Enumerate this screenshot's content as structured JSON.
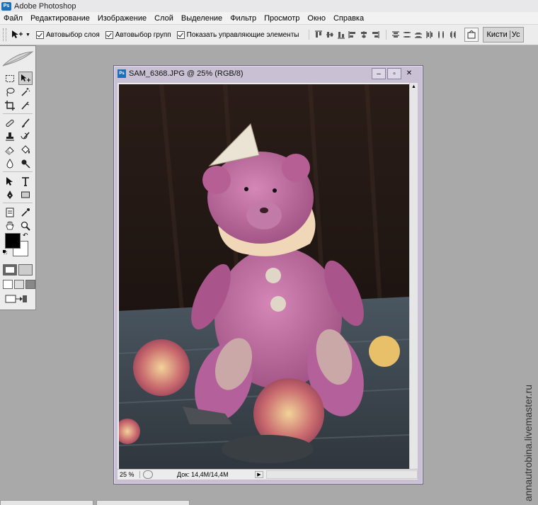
{
  "app": {
    "title": "Adobe Photoshop",
    "icon_label": "Ps"
  },
  "menu": [
    "Файл",
    "Редактирование",
    "Изображение",
    "Слой",
    "Выделение",
    "Фильтр",
    "Просмотр",
    "Окно",
    "Справка"
  ],
  "options": {
    "auto_select_layer": "Автовыбор слоя",
    "auto_select_groups": "Автовыбор групп",
    "show_controls": "Показать управляющие элементы",
    "brushes_tab": "Кисти",
    "brushes_tab_extra": "Ус"
  },
  "document": {
    "title": "SAM_6368.JPG @ 25% (RGB/8)",
    "zoom": "25 %",
    "info": "Док: 14,4M/14,4M"
  },
  "watermark": "annautrobina.livemaster.ru",
  "colors": {
    "foreground": "#000000",
    "background": "#ffffff",
    "window_frame": "#c9c1d3"
  }
}
